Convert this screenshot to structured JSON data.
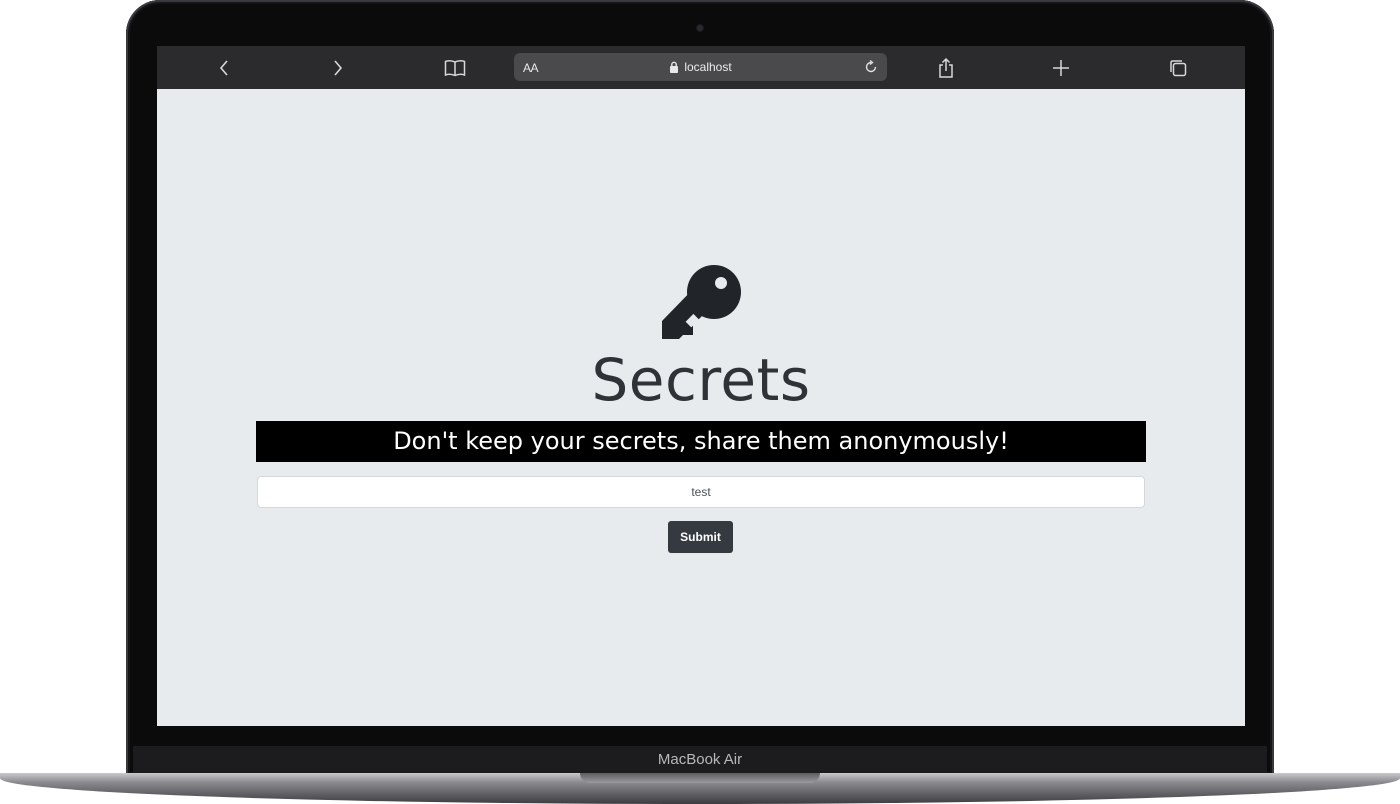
{
  "device": {
    "model_label": "MacBook Air"
  },
  "browser": {
    "text_size_label": "AA",
    "url": "localhost",
    "icons": {
      "back": "chevron-left-icon",
      "forward": "chevron-right-icon",
      "bookmarks": "book-icon",
      "lock": "lock-icon",
      "reload": "reload-icon",
      "share": "share-icon",
      "new_tab": "plus-icon",
      "tabs": "tabs-icon"
    }
  },
  "page": {
    "logo_icon": "key-icon",
    "title": "Secrets",
    "tagline": "Don't keep your secrets, share them anonymously!",
    "secret_input": {
      "value": "test"
    },
    "submit_label": "Submit"
  },
  "colors": {
    "page_background": "#e8ebee",
    "banner_background": "#000000",
    "button_background": "#343a40",
    "toolbar_background": "#2b2b2d"
  }
}
